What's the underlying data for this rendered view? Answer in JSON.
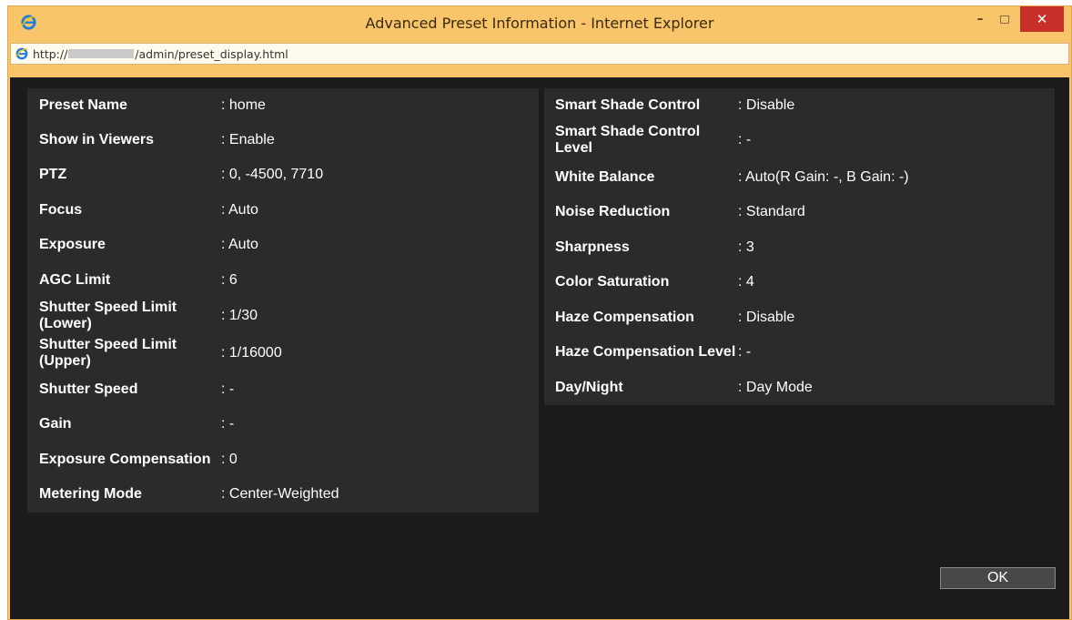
{
  "window": {
    "title": "Advanced Preset Information - Internet Explorer",
    "minimize": "–",
    "close": "✕"
  },
  "address": {
    "prefix": "http://",
    "suffix": "/admin/preset_display.html"
  },
  "left_rows": [
    {
      "label": "Preset Name",
      "value": ": home"
    },
    {
      "label": "Show in Viewers",
      "value": ": Enable"
    },
    {
      "label": "PTZ",
      "value": ": 0, -4500, 7710"
    },
    {
      "label": "Focus",
      "value": ": Auto"
    },
    {
      "label": "Exposure",
      "value": ": Auto"
    },
    {
      "label": "AGC Limit",
      "value": ": 6"
    },
    {
      "label": "Shutter Speed Limit (Lower)",
      "value": ": 1/30"
    },
    {
      "label": "Shutter Speed Limit (Upper)",
      "value": ": 1/16000"
    },
    {
      "label": "Shutter Speed",
      "value": ": -"
    },
    {
      "label": "Gain",
      "value": ": -"
    },
    {
      "label": "Exposure Compensation",
      "value": ": 0"
    },
    {
      "label": "Metering Mode",
      "value": ": Center-Weighted"
    }
  ],
  "right_rows": [
    {
      "label": "Smart Shade Control",
      "value": ": Disable"
    },
    {
      "label": "Smart Shade Control Level",
      "value": ": -"
    },
    {
      "label": "White Balance",
      "value": ": Auto(R Gain: -, B Gain: -)"
    },
    {
      "label": "Noise Reduction",
      "value": ": Standard"
    },
    {
      "label": "Sharpness",
      "value": ": 3"
    },
    {
      "label": "Color Saturation",
      "value": ": 4"
    },
    {
      "label": "Haze Compensation",
      "value": ": Disable"
    },
    {
      "label": "Haze Compensation Level",
      "value": ": -"
    },
    {
      "label": "Day/Night",
      "value": ": Day Mode"
    }
  ],
  "ok_label": "OK"
}
